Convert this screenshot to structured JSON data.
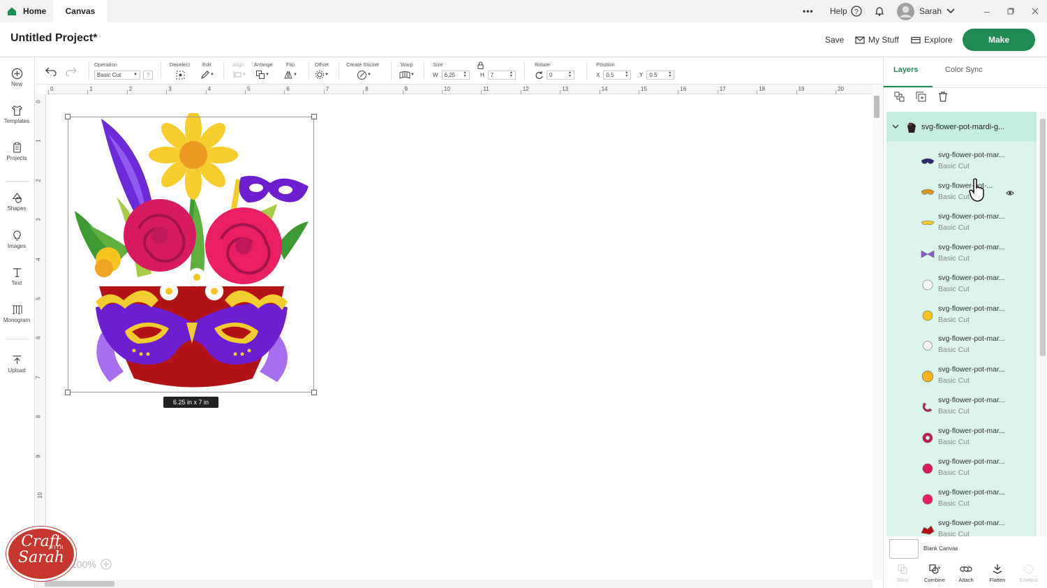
{
  "top_bar": {
    "home_label": "Home",
    "canvas_label": "Canvas",
    "more_label": "•••",
    "help_label": "Help",
    "user_name": "Sarah"
  },
  "title_bar": {
    "project_title": "Untitled Project*",
    "save_label": "Save",
    "mystuff_label": "My Stuff",
    "explore_label": "Explore",
    "make_label": "Make"
  },
  "left_sidebar": {
    "items": [
      {
        "label": "New",
        "icon": "plus-circle-icon"
      },
      {
        "label": "Templates",
        "icon": "shirt-icon"
      },
      {
        "label": "Projects",
        "icon": "clipboard-icon"
      },
      {
        "label": "Shapes",
        "icon": "shapes-icon"
      },
      {
        "label": "Images",
        "icon": "bulb-icon"
      },
      {
        "label": "Text",
        "icon": "text-icon"
      },
      {
        "label": "Monogram",
        "icon": "monogram-icon"
      },
      {
        "label": "Upload",
        "icon": "upload-icon"
      }
    ]
  },
  "toolbar": {
    "operation_label": "Operation",
    "operation_value": "Basic Cut",
    "deselect_label": "Deselect",
    "edit_label": "Edit",
    "align_label": "Align",
    "arrange_label": "Arrange",
    "flip_label": "Flip",
    "offset_label": "Offset",
    "sticker_label": "Create Sticker",
    "warp_label": "Warp",
    "size_label": "Size",
    "w_label": "W",
    "w_value": "6.25",
    "h_label": "H",
    "h_value": "7",
    "rotate_label": "Rotate",
    "rotate_value": "0",
    "position_label": "Position",
    "x_label": "X",
    "x_value": "0.5",
    "y_label": "Y",
    "y_value": "0.5"
  },
  "ruler": {
    "top": [
      "0",
      "1",
      "2",
      "3",
      "4",
      "5",
      "6",
      "7",
      "8",
      "9",
      "10",
      "11",
      "12",
      "13",
      "14",
      "15",
      "16",
      "17",
      "18",
      "19",
      "20"
    ],
    "left": [
      "0",
      "1",
      "2",
      "3",
      "4",
      "5",
      "6",
      "7",
      "8",
      "9",
      "10"
    ]
  },
  "canvas": {
    "size_tag": "6.25  in x 7  in",
    "zoom": "100%"
  },
  "logo": {
    "line1": "Craft",
    "with": "WITH",
    "line2": "Sarah"
  },
  "right_panel": {
    "tab_layers": "Layers",
    "tab_color_sync": "Color Sync",
    "group_name": "svg-flower-pot-mardi-g...",
    "layers": [
      {
        "name": "svg-flower-pot-mar...",
        "op": "Basic Cut",
        "color": "#2b2a6b"
      },
      {
        "name": "svg-flower-pot-...",
        "op": "Basic Cut",
        "color": "#d99a1c"
      },
      {
        "name": "svg-flower-pot-mar...",
        "op": "Basic Cut",
        "color": "#f2cc2e"
      },
      {
        "name": "svg-flower-pot-mar...",
        "op": "Basic Cut",
        "color": "#8b5bd6"
      },
      {
        "name": "svg-flower-pot-mar...",
        "op": "Basic Cut",
        "color": "#ffffff"
      },
      {
        "name": "svg-flower-pot-mar...",
        "op": "Basic Cut",
        "color": "#f7c520"
      },
      {
        "name": "svg-flower-pot-mar...",
        "op": "Basic Cut",
        "color": "#f5f5f5"
      },
      {
        "name": "svg-flower-pot-mar...",
        "op": "Basic Cut",
        "color": "#f0b51f"
      },
      {
        "name": "svg-flower-pot-mar...",
        "op": "Basic Cut",
        "color": "#c2185b"
      },
      {
        "name": "svg-flower-pot-mar...",
        "op": "Basic Cut",
        "color": "#c8174e"
      },
      {
        "name": "svg-flower-pot-mar...",
        "op": "Basic Cut",
        "color": "#d81b60"
      },
      {
        "name": "svg-flower-pot-mar...",
        "op": "Basic Cut",
        "color": "#e91e63"
      },
      {
        "name": "svg-flower-pot-mar...",
        "op": "Basic Cut",
        "color": "#b31217"
      }
    ],
    "blank_canvas_label": "Blank Canvas",
    "bottom_tools": [
      {
        "label": "Slice",
        "enabled": false
      },
      {
        "label": "Combine",
        "enabled": true
      },
      {
        "label": "Attach",
        "enabled": true
      },
      {
        "label": "Flatten",
        "enabled": true
      },
      {
        "label": "Contour",
        "enabled": false
      }
    ]
  },
  "colors": {
    "accent": "#1f8b53",
    "layer_panel_bg": "#dbf3ea",
    "layer_group_bg": "#c7ede0"
  }
}
